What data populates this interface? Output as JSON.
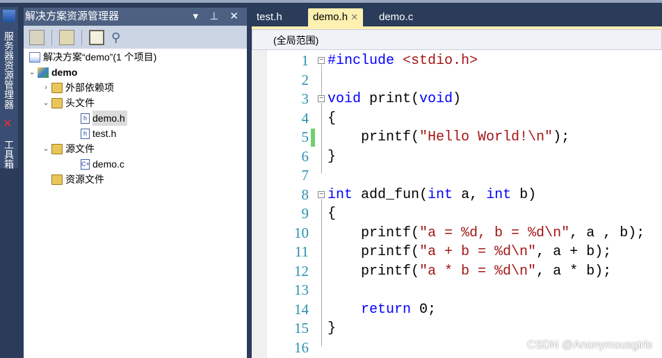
{
  "side_tabs": [
    "服务器资源管理器",
    "工具箱"
  ],
  "panel": {
    "title": "解决方案资源管理器",
    "buttons": "▾ ⊥ ✕",
    "tree": [
      {
        "label": "解决方案“demo”(1 个项目)",
        "icon": "solution-icon",
        "level": 0,
        "arrow": ""
      },
      {
        "label": "demo",
        "icon": "project-icon",
        "level": 0,
        "arrow": "⌄",
        "bold": true
      },
      {
        "label": "外部依赖项",
        "icon": "folder-link-icon",
        "level": 1,
        "arrow": "›"
      },
      {
        "label": "头文件",
        "icon": "folder-open-icon",
        "level": 1,
        "arrow": "⌄"
      },
      {
        "label": "demo.h",
        "icon": "header-file-icon",
        "level": 2,
        "arrow": "",
        "selected": true
      },
      {
        "label": "test.h",
        "icon": "header-file-icon",
        "level": 2,
        "arrow": ""
      },
      {
        "label": "源文件",
        "icon": "folder-open-icon",
        "level": 1,
        "arrow": "⌄"
      },
      {
        "label": "demo.c",
        "icon": "cpp-file-icon",
        "level": 2,
        "arrow": ""
      },
      {
        "label": "资源文件",
        "icon": "folder-icon",
        "level": 1,
        "arrow": ""
      }
    ]
  },
  "editor": {
    "tabs": [
      {
        "label": "test.h"
      },
      {
        "label": "demo.h",
        "active": true,
        "close": "✕"
      },
      {
        "label": "demo.c"
      }
    ],
    "scope": "(全局范围)",
    "lines": [
      [
        [
          "p",
          "#include "
        ],
        [
          "s",
          "<stdio.h>"
        ]
      ],
      [],
      [
        [
          "k",
          "void"
        ],
        [
          "n",
          " print("
        ],
        [
          "k",
          "void"
        ],
        [
          "n",
          ")"
        ]
      ],
      [
        [
          "n",
          "{"
        ]
      ],
      [
        [
          "n",
          "    printf("
        ],
        [
          "s",
          "\"Hello World!\\n\""
        ],
        [
          "n",
          ");"
        ]
      ],
      [
        [
          "n",
          "}"
        ]
      ],
      [],
      [
        [
          "k",
          "int"
        ],
        [
          "n",
          " add_fun("
        ],
        [
          "k",
          "int"
        ],
        [
          "n",
          " a, "
        ],
        [
          "k",
          "int"
        ],
        [
          "n",
          " b)"
        ]
      ],
      [
        [
          "n",
          "{"
        ]
      ],
      [
        [
          "n",
          "    printf("
        ],
        [
          "s",
          "\"a = %d, b = %d\\n\""
        ],
        [
          "n",
          ", a , b);"
        ]
      ],
      [
        [
          "n",
          "    printf("
        ],
        [
          "s",
          "\"a + b = %d\\n\""
        ],
        [
          "n",
          ", a + b);"
        ]
      ],
      [
        [
          "n",
          "    printf("
        ],
        [
          "s",
          "\"a * b = %d\\n\""
        ],
        [
          "n",
          ", a * b);"
        ]
      ],
      [],
      [
        [
          "n",
          "    "
        ],
        [
          "k",
          "return"
        ],
        [
          "n",
          " 0;"
        ]
      ],
      [
        [
          "n",
          "}"
        ]
      ],
      []
    ]
  },
  "watermark": "CSDN @Anonymousgirls",
  "colors": {
    "keyword": "#0000ff",
    "string": "#a31515",
    "line_number": "#2b91af",
    "tab_active": "#fdf0b0",
    "changed_marker": "#6ed06e"
  }
}
